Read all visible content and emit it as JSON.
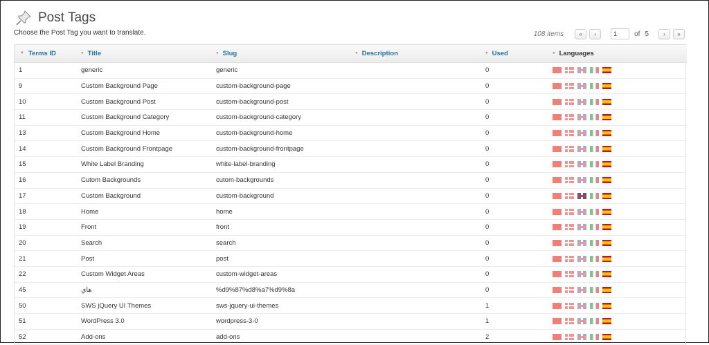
{
  "page": {
    "title": "Post Tags",
    "subtitle": "Choose the Post Tag you want to translate."
  },
  "pager": {
    "items_count": "108 items",
    "first": "«",
    "prev": "‹",
    "current_page": "1",
    "of_label": "of",
    "total_pages": "5",
    "next": "›",
    "last": "»"
  },
  "columns": {
    "terms_id": "Terms ID",
    "title": "Title",
    "slug": "Slug",
    "description": "Description",
    "used": "Used",
    "languages": "Languages"
  },
  "language_flags": [
    "flag-cn-icon",
    "flag-dk-icon",
    "flag-gb-icon",
    "flag-it-icon",
    "flag-es-icon"
  ],
  "rows": [
    {
      "id": "1",
      "title": "generic",
      "slug": "generic",
      "description": "",
      "used": "0"
    },
    {
      "id": "9",
      "title": "Custom Background Page",
      "slug": "custom-background-page",
      "description": "",
      "used": "0"
    },
    {
      "id": "10",
      "title": "Custom Background Post",
      "slug": "custom-background-post",
      "description": "",
      "used": "0"
    },
    {
      "id": "11",
      "title": "Custom Background Category",
      "slug": "custom-background-category",
      "description": "",
      "used": "0"
    },
    {
      "id": "13",
      "title": "Custom Background Home",
      "slug": "custom-background-home",
      "description": "",
      "used": "0"
    },
    {
      "id": "14",
      "title": "Custom Background Frontpage",
      "slug": "custom-background-frontpage",
      "description": "",
      "used": "0"
    },
    {
      "id": "15",
      "title": "White Label Branding",
      "slug": "white-label-branding",
      "description": "",
      "used": "0"
    },
    {
      "id": "16",
      "title": "Cutom Backgrounds",
      "slug": "cutom-backgrounds",
      "description": "",
      "used": "0"
    },
    {
      "id": "17",
      "title": "Custom Background",
      "slug": "custom-background",
      "description": "",
      "used": "0",
      "gb_active": true
    },
    {
      "id": "18",
      "title": "Home",
      "slug": "home",
      "description": "",
      "used": "0"
    },
    {
      "id": "19",
      "title": "Front",
      "slug": "front",
      "description": "",
      "used": "0"
    },
    {
      "id": "20",
      "title": "Search",
      "slug": "search",
      "description": "",
      "used": "0"
    },
    {
      "id": "21",
      "title": "Post",
      "slug": "post",
      "description": "",
      "used": "0"
    },
    {
      "id": "22",
      "title": "Custom Widget Areas",
      "slug": "custom-widget-areas",
      "description": "",
      "used": "0"
    },
    {
      "id": "45",
      "title": "هاي",
      "slug": "%d9%87%d8%a7%d9%8a",
      "description": "",
      "used": "0"
    },
    {
      "id": "50",
      "title": "SWS jQuery UI Themes",
      "slug": "sws-jquery-ui-themes",
      "description": "",
      "used": "1"
    },
    {
      "id": "51",
      "title": "WordPress 3.0",
      "slug": "wordpress-3-0",
      "description": "",
      "used": "1"
    },
    {
      "id": "52",
      "title": "Add-ons",
      "slug": "add-ons",
      "description": "",
      "used": "2"
    }
  ]
}
